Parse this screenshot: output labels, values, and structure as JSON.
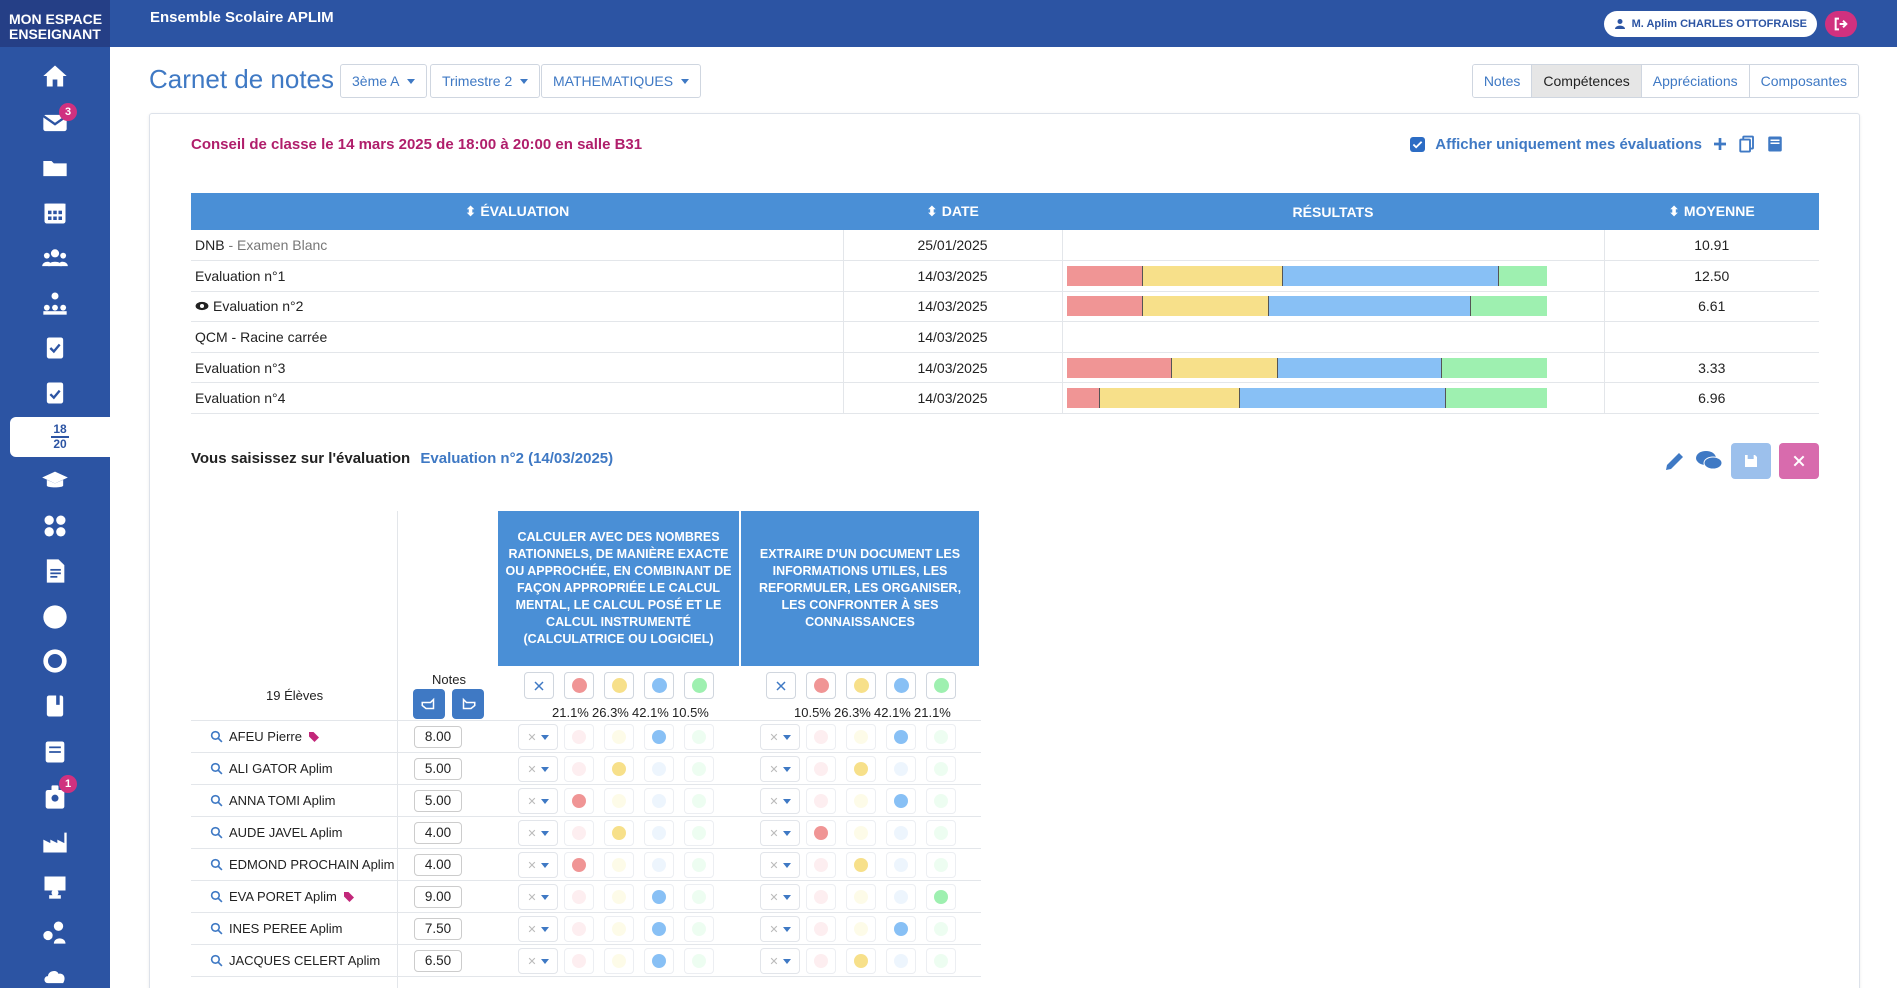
{
  "brand": {
    "line1": "MON ESPACE",
    "line2": "ENSEIGNANT"
  },
  "school": "Ensemble Scolaire APLIM",
  "user": "M. Aplim CHARLES OTTOFRAISE",
  "sidebar": {
    "badges": {
      "messages": "3",
      "alerts": "1"
    },
    "grade_fraction": {
      "num": "18",
      "den": "20"
    }
  },
  "header": {
    "title": "Carnet de notes",
    "class_select": "3ème A",
    "period_select": "Trimestre 2",
    "subject_select": "MATHEMATIQUES",
    "tabs": [
      "Notes",
      "Compétences",
      "Appréciations",
      "Composantes"
    ]
  },
  "conseil": "Conseil de classe le 14 mars 2025 de 18:00 à 20:00 en salle B31",
  "filter_label": "Afficher uniquement mes évaluations",
  "colors": {
    "red": "#f09595",
    "yellow": "#f7e08a",
    "blue": "#88c0f5",
    "green": "#9ef0b0",
    "primary": "#2c54a3",
    "accent": "#d0317f"
  },
  "eval_table": {
    "headers": [
      "ÉVALUATION",
      "DATE",
      "RÉSULTATS",
      "MOYENNE"
    ],
    "rows": [
      {
        "name": "DNB",
        "sub": " - Examen Blanc",
        "date": "25/01/2025",
        "avg": "10.91",
        "results": null,
        "eye": false
      },
      {
        "name": "Evaluation n°1",
        "sub": "",
        "date": "14/03/2025",
        "avg": "12.50",
        "results": [
          16,
          29,
          45,
          10
        ],
        "eye": false
      },
      {
        "name": "Evaluation n°2",
        "sub": "",
        "date": "14/03/2025",
        "avg": "6.61",
        "results": [
          16,
          26,
          42,
          16
        ],
        "eye": true
      },
      {
        "name": "QCM - Racine carrée",
        "sub": "",
        "date": "14/03/2025",
        "avg": "",
        "results": null,
        "eye": false
      },
      {
        "name": "Evaluation n°3",
        "sub": "",
        "date": "14/03/2025",
        "avg": "3.33",
        "results": [
          22,
          22,
          34,
          22
        ],
        "eye": false
      },
      {
        "name": "Evaluation n°4",
        "sub": "",
        "date": "14/03/2025",
        "avg": "6.96",
        "results": [
          7,
          29,
          43,
          21
        ],
        "eye": false
      }
    ]
  },
  "saisie": {
    "label": "Vous saisissez sur l'évaluation",
    "eval": "Evaluation n°2 (14/03/2025)"
  },
  "grid": {
    "count_label": "19 Élèves",
    "notes_label": "Notes",
    "competences": [
      {
        "label": "CALCULER AVEC DES NOMBRES RATIONNELS, DE MANIÈRE EXACTE OU APPROCHÉE, EN COMBINANT DE FAÇON APPROPRIÉE LE CALCUL MENTAL, LE CALCUL POSÉ ET LE CALCUL INSTRUMENTÉ (CALCULATRICE OU LOGICIEL)",
        "pcts": [
          "21.1%",
          "26.3%",
          "42.1%",
          "10.5%"
        ]
      },
      {
        "label": "EXTRAIRE D'UN DOCUMENT LES INFORMATIONS UTILES, LES REFORMULER, LES ORGANISER, LES CONFRONTER À SES CONNAISSANCES",
        "pcts": [
          "10.5%",
          "26.3%",
          "42.1%",
          "21.1%"
        ]
      }
    ],
    "students": [
      {
        "name": "AFEU Pierre",
        "tag": true,
        "note": "8.00",
        "c1": 3,
        "c2": 3
      },
      {
        "name": "ALI GATOR Aplim",
        "tag": false,
        "note": "5.00",
        "c1": 2,
        "c2": 2
      },
      {
        "name": "ANNA TOMI Aplim",
        "tag": false,
        "note": "5.00",
        "c1": 1,
        "c2": 3
      },
      {
        "name": "AUDE JAVEL Aplim",
        "tag": false,
        "note": "4.00",
        "c1": 2,
        "c2": 1
      },
      {
        "name": "EDMOND PROCHAIN Aplim",
        "tag": false,
        "note": "4.00",
        "c1": 1,
        "c2": 2
      },
      {
        "name": "EVA PORET Aplim",
        "tag": true,
        "note": "9.00",
        "c1": 3,
        "c2": 4
      },
      {
        "name": "INES PEREE Aplim",
        "tag": false,
        "note": "7.50",
        "c1": 3,
        "c2": 3
      },
      {
        "name": "JACQUES CELERT Aplim",
        "tag": false,
        "note": "6.50",
        "c1": 3,
        "c2": 2
      }
    ]
  }
}
